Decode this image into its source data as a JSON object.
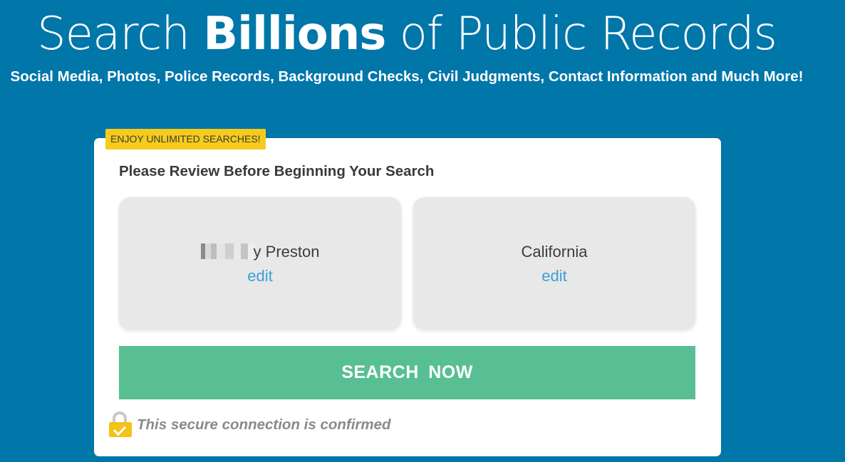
{
  "hero": {
    "title_before": "Search ",
    "title_bold": "Billions",
    "title_after": " of Public Records",
    "subtitle": "Social Media, Photos, Police Records, Background Checks, Civil Judgments, Contact Information and Much More!"
  },
  "card": {
    "badge": "ENJOY UNLIMITED SEARCHES!",
    "heading": "Please Review Before Beginning Your Search",
    "name_box": {
      "name_visible_suffix": "y Preston",
      "edit_label": "edit"
    },
    "state_box": {
      "state": "California",
      "edit_label": "edit"
    },
    "search_button_label": "SEARCH  NOW",
    "secure_text": "This secure connection is confirmed",
    "secure_icon": "lock-check-icon"
  },
  "colors": {
    "background": "#0176a9",
    "badge": "#f6cb1b",
    "button": "#58bf93",
    "link": "#3a9fd6"
  }
}
